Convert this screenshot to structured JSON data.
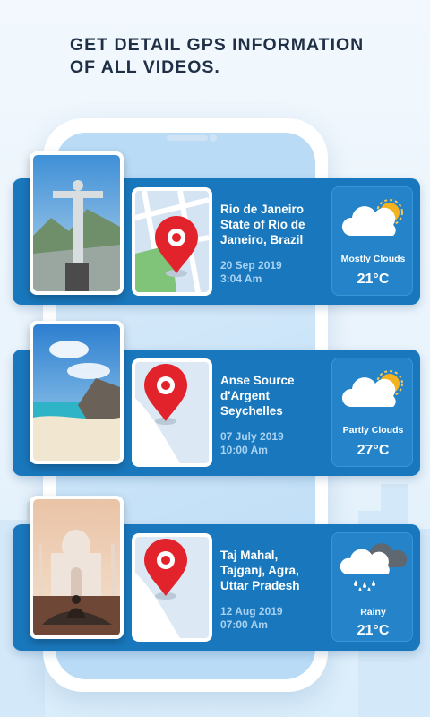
{
  "header": {
    "line1": "GET DETAIL GPS INFORMATION",
    "line2": "OF ALL VIDEOS."
  },
  "cards": [
    {
      "place": [
        "Rio de Janeiro",
        "State of Rio de",
        "Janeiro, Brazil"
      ],
      "date": "20 Sep 2019",
      "time": "3:04 Am",
      "weather": "Mostly Clouds",
      "temp": "21°C",
      "weather_icon": "cloud-sun-icon",
      "photo_subject": "christ-the-redeemer"
    },
    {
      "place": [
        "Anse Source",
        "d'Argent",
        "Seychelles"
      ],
      "date": "07 July 2019",
      "time": "10:00 Am",
      "weather": "Partly Clouds",
      "temp": "27°C",
      "weather_icon": "cloud-sun-icon",
      "photo_subject": "beach"
    },
    {
      "place": [
        "Taj Mahal,",
        "Tajganj, Agra,",
        "Uttar Pradesh"
      ],
      "date": "12 Aug 2019",
      "time": "07:00 Am",
      "weather": "Rainy",
      "temp": "21°C",
      "weather_icon": "rain-cloud-icon",
      "photo_subject": "taj-mahal"
    }
  ],
  "colors": {
    "card": "#1978bd",
    "weather_box": "#2483c9",
    "pin": "#e3232b",
    "headline": "#1f2f45"
  }
}
